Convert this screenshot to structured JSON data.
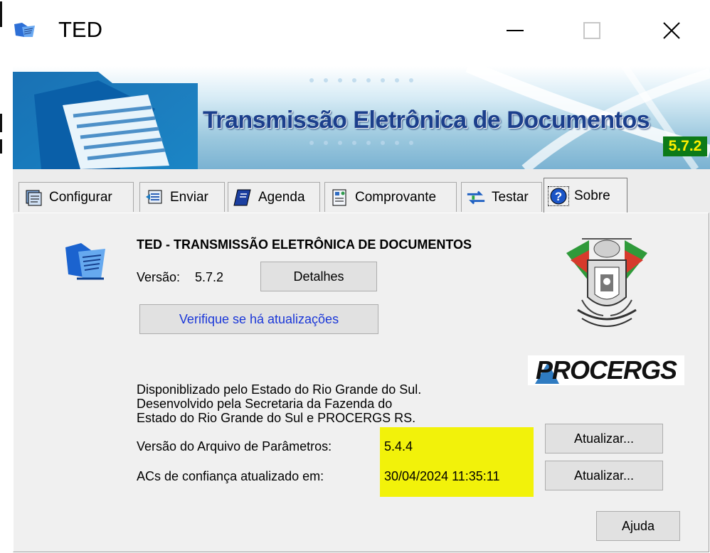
{
  "window": {
    "title": "TED",
    "minimize_icon": "minimize-icon",
    "maximize_icon": "maximize-icon",
    "close_icon": "close-icon"
  },
  "banner": {
    "title": "Transmissão Eletrônica de Documentos",
    "version_badge": "5.7.2"
  },
  "tabs": [
    {
      "label": "Configurar",
      "icon": "configure-icon"
    },
    {
      "label": "Enviar",
      "icon": "send-icon"
    },
    {
      "label": "Agenda",
      "icon": "agenda-icon"
    },
    {
      "label": "Comprovante",
      "icon": "receipt-icon"
    },
    {
      "label": "Testar",
      "icon": "test-icon"
    },
    {
      "label": "Sobre",
      "icon": "help-icon",
      "active": true
    }
  ],
  "about": {
    "heading": "TED - TRANSMISSÃO ELETRÔNICA DE DOCUMENTOS",
    "version_label": "Versão:",
    "version_value": "5.7.2",
    "details_button": "Detalhes",
    "check_updates_button": "Verifique se há atualizações",
    "description_lines": [
      "Disponiblizado pelo Estado do Rio Grande do Sul.",
      "Desenvolvido pela Secretaria da Fazenda do",
      "Estado do Rio Grande do Sul e PROCERGS RS."
    ],
    "params_label": "Versão do Arquivo de Parâmetros:",
    "params_value": "5.4.4",
    "params_update_button": "Atualizar...",
    "acs_label": "ACs de confiança atualizado em:",
    "acs_value": "30/04/2024 11:35:11",
    "acs_update_button": "Atualizar...",
    "help_button": "Ajuda",
    "procergs_logo_text": "PROCERGS",
    "coat_of_arms": "rio-grande-do-sul-coat-of-arms",
    "highlight_color": "#f2f20a"
  },
  "colors": {
    "banner_title": "#1c3f8c",
    "badge_bg": "#0c7a18",
    "badge_text": "#ffef00",
    "link": "#1a37d8"
  }
}
